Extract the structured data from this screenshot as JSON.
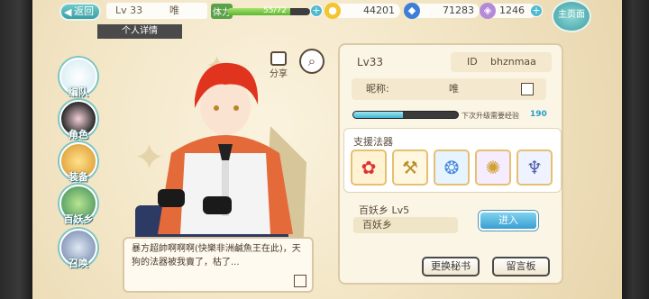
{
  "header": {
    "back_label": "返回",
    "level": "Lv 33",
    "name": "唯",
    "stamina_label": "体力",
    "stamina_text": "55/72",
    "stamina_fraction": 0.76,
    "coins": "44201",
    "gems": "71283",
    "crystals": "1246",
    "home_label": "主页面",
    "tab_label": "个人详情"
  },
  "sidebar": {
    "items": [
      {
        "label": "编队"
      },
      {
        "label": "角色"
      },
      {
        "label": "装备"
      },
      {
        "label": "百妖乡"
      },
      {
        "label": "召唤"
      }
    ]
  },
  "toolbar": {
    "share_label": "分享"
  },
  "dialog": {
    "text": "暴方超帥啊啊啊(快樂非洲鹹魚王在此)，天狗的法器被我賣了，枯了..."
  },
  "profile": {
    "level": "Lv33",
    "id_key": "ID",
    "id_value": "bhznmaa",
    "nick_key": "昵称:",
    "nick_value": "唯",
    "exp_label": "下次升级需要经验",
    "exp_value": "190",
    "exp_fraction": 0.47,
    "support_title": "支援法器",
    "realm_title": "百妖乡  Lv5",
    "realm_name": "百妖乡",
    "enter_label": "进入",
    "change_secretary_label": "更换秘书",
    "message_board_label": "留言板"
  },
  "colors": {
    "accent": "#3c9ea3",
    "gold": "#e6c070",
    "panel": "#fbf5e6"
  }
}
